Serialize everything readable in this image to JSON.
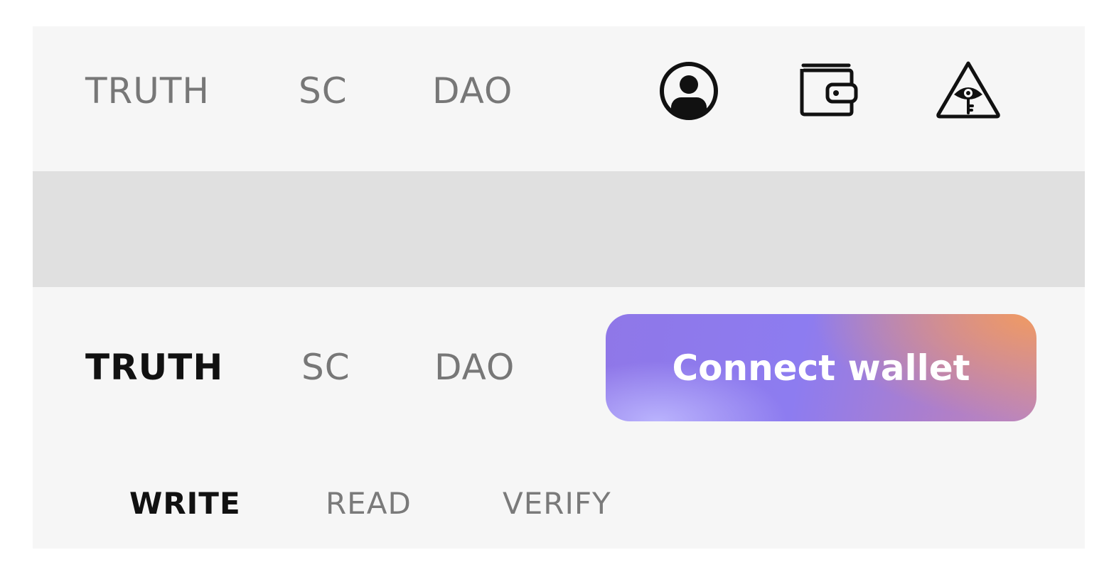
{
  "top_nav": {
    "links": [
      {
        "label": "TRUTH"
      },
      {
        "label": "SC"
      },
      {
        "label": "DAO"
      }
    ],
    "icons": [
      {
        "name": "user-icon"
      },
      {
        "name": "wallet-icon"
      },
      {
        "name": "eye-triangle-icon"
      }
    ]
  },
  "bottom_nav": {
    "links": [
      {
        "label": "TRUTH",
        "active": true
      },
      {
        "label": "SC",
        "active": false
      },
      {
        "label": "DAO",
        "active": false
      }
    ],
    "connect_button_label": "Connect wallet",
    "sub_tabs": [
      {
        "label": "WRITE",
        "active": true
      },
      {
        "label": "READ",
        "active": false
      },
      {
        "label": "VERIFY",
        "active": false
      }
    ]
  },
  "colors": {
    "text_muted": "#777777",
    "text_active": "#111111",
    "gradient_start": "#8f77e8",
    "gradient_mid": "#8d7cf0",
    "gradient_end": "#f09a62"
  }
}
